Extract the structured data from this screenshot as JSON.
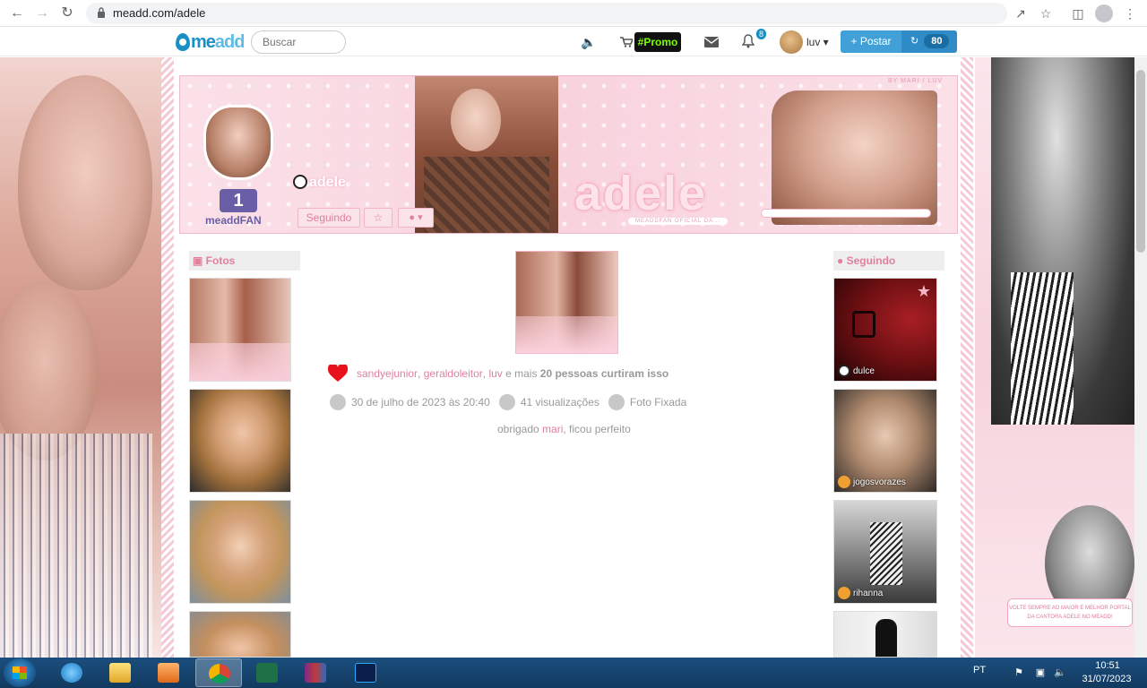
{
  "browser": {
    "url": "meadd.com/adele"
  },
  "site": {
    "logo_me": "me",
    "logo_add": "add",
    "search_placeholder": "Buscar",
    "promo_label": "#Promo",
    "notifications_count": "8",
    "username": "luv",
    "post_button": "+ Postar",
    "counter_value": "80"
  },
  "profile": {
    "name": "adele",
    "banner_title": "adele",
    "banner_credit": "BY MARI / LUV",
    "banner_subtitle": "MEADDFAN OFICIAL DA...",
    "fan_rank": "1",
    "fan_label": "meaddFAN",
    "following_button": "Seguindo"
  },
  "sidebar_left": {
    "heading": "Fotos"
  },
  "sidebar_right": {
    "heading": "Seguindo",
    "following": [
      {
        "name": "dulce",
        "badge": "panda"
      },
      {
        "name": "jogosvorazes",
        "badge": "gem"
      },
      {
        "name": "rihanna",
        "badge": "gem"
      }
    ]
  },
  "post": {
    "liked_by": [
      "sandyejunior",
      "geraldoleitor",
      "luv"
    ],
    "likes_suffix": " e mais ",
    "likes_more": "20 pessoas curtiram isso",
    "date": "30 de julho de 2023 às 20:40",
    "views": "41 visualizações",
    "pinned_label": "Foto Fixada",
    "comment_pre": "obrigado ",
    "comment_user": "mari",
    "comment_post": ", ficou perfeito"
  },
  "right_panel_sign": "VOLTE SEMPRE AO MAIOR E MELHOR PORTAL DA CANTORA ADELE NO MEADD!",
  "taskbar": {
    "language": "PT",
    "time": "10:51",
    "date": "31/07/2023"
  },
  "colors": {
    "accent_pink": "#e0809d",
    "brand_blue": "#1a8fc4",
    "promo_green": "#7cfc00",
    "heart_red": "#e8111c"
  }
}
